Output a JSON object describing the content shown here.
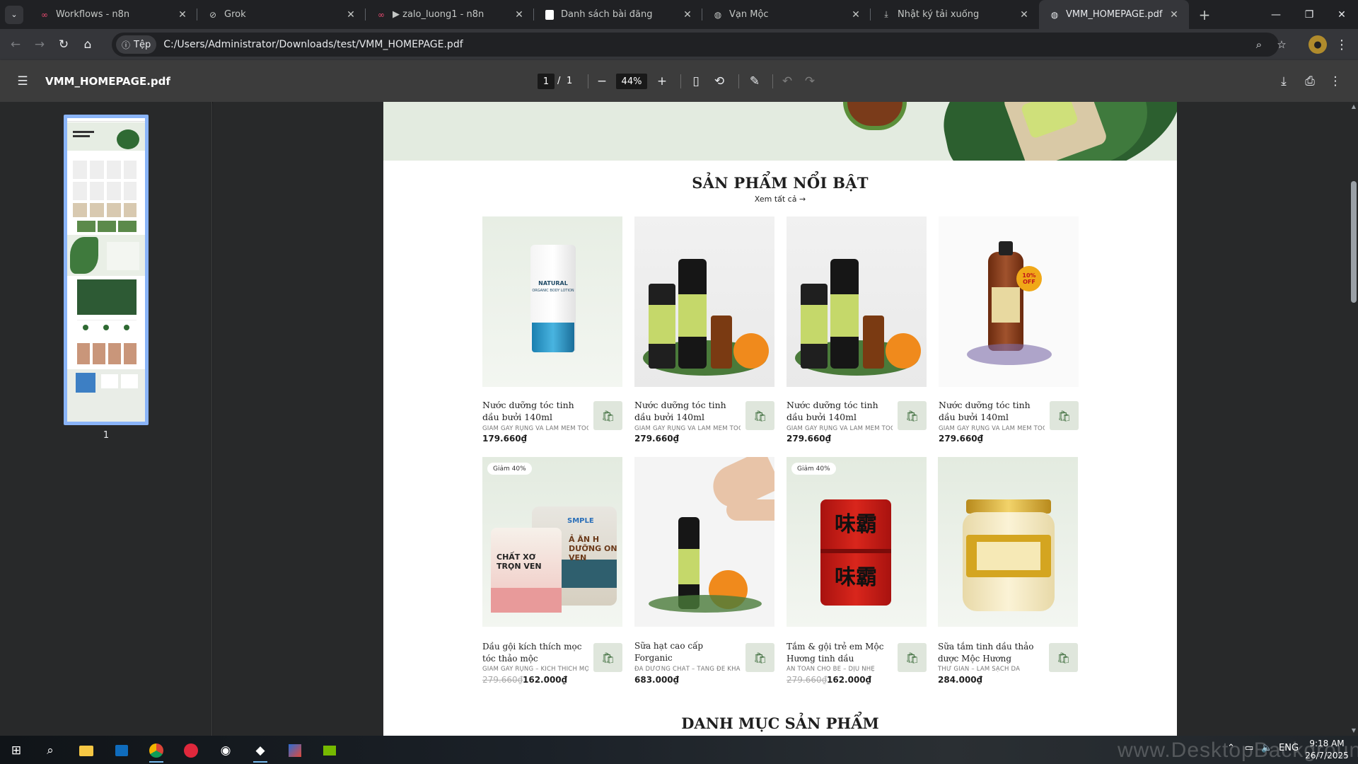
{
  "browser": {
    "tabs": [
      {
        "title": "Workflows - n8n",
        "icon": "n8n-icon"
      },
      {
        "title": "Grok",
        "icon": "grok-icon"
      },
      {
        "title": "▶ zalo_luong1 - n8n",
        "icon": "n8n-icon"
      },
      {
        "title": "Danh sách bài đăng",
        "icon": "doc-icon"
      },
      {
        "title": "Vạn Mộc",
        "icon": "globe-icon"
      },
      {
        "title": "Nhật ký tải xuống",
        "icon": "download-icon"
      },
      {
        "title": "VMM_HOMEPAGE.pdf",
        "icon": "globe-icon",
        "active": true
      }
    ],
    "address_chip": "Tệp",
    "url": "C:/Users/Administrator/Downloads/test/VMM_HOMEPAGE.pdf",
    "accent": "#8ab4f8"
  },
  "pdf_viewer": {
    "file_name": "VMM_HOMEPAGE.pdf",
    "current_page": "1",
    "page_sep": "/",
    "total_pages": "1",
    "zoom": "44%",
    "thumbnail_label": "1"
  },
  "document": {
    "featured_title": "SẢN PHẨM NỔI BẬT",
    "see_all": "Xem tất cả →",
    "products": [
      {
        "name": "Nước dưỡng tóc tinh dầu bưởi 140ml",
        "subtitle": "GIẢM GÃY RỤNG VÀ LÀM MỀM TÓC",
        "price": "179.660₫",
        "old_price": "",
        "badge": ""
      },
      {
        "name": "Nước dưỡng tóc tinh dầu bưởi 140ml",
        "subtitle": "GIẢM GÃY RỤNG VÀ LÀM MỀM TÓC",
        "price": "279.660₫",
        "old_price": "",
        "badge": ""
      },
      {
        "name": "Nước dưỡng tóc tinh dầu bưởi 140ml",
        "subtitle": "GIẢM GÃY RỤNG VÀ LÀM MỀM TÓC",
        "price": "279.660₫",
        "old_price": "",
        "badge": ""
      },
      {
        "name": "Nước dưỡng tóc tinh dầu bưởi 140ml",
        "subtitle": "GIẢM GÃY RỤNG VÀ LÀM MỀM TÓC",
        "price": "279.660₫",
        "old_price": "",
        "badge": ""
      },
      {
        "name": "Dầu gội kích thích mọc tóc thảo mộc",
        "subtitle": "GIẢM GÃY RỤNG – KÍCH THÍCH MỌC TÓC",
        "price": "162.000₫",
        "old_price": "279.660₫",
        "badge": "Giảm 40%"
      },
      {
        "name": "Sữa hạt cao cấp Forganic",
        "subtitle": "ĐA DƯỠNG CHẤT – TĂNG ĐỀ KHÁNG",
        "price": "683.000₫",
        "old_price": "",
        "badge": ""
      },
      {
        "name": "Tắm & gội trẻ em Mộc Hương tinh dầu",
        "subtitle": "AN TOÀN CHO BÉ – DỊU NHẸ",
        "price": "162.000₫",
        "old_price": "279.660₫",
        "badge": "Giảm 40%"
      },
      {
        "name": "Sữa tắm tinh dầu thảo dược Mộc Hương",
        "subtitle": "THƯ GIÃN – LÀM SẠCH DA",
        "price": "284.000₫",
        "old_price": "",
        "badge": ""
      }
    ],
    "category_title": "DANH MỤC SẢN PHẨM",
    "product_art": {
      "lotion_text": "NATURAL",
      "lotion_sub": "ORGANIC BODY LOTION",
      "discount_sticker": "10% OFF",
      "milk_brand": "SMPLE",
      "milk_text": "CHẤT XƠ TRỌN VEN",
      "milk_text2": "Ả ĂN H DƯỠNG ON VEN",
      "tin_text": "味霸"
    }
  },
  "taskbar": {
    "time": "9:18 AM",
    "date": "26/7/2025",
    "watermark": "www.DesktopBackground"
  }
}
